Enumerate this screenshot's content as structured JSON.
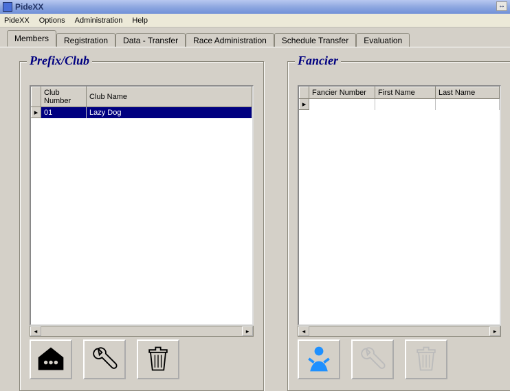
{
  "window": {
    "title": "PideXX"
  },
  "menu": {
    "items": [
      "PideXX",
      "Options",
      "Administration",
      "Help"
    ]
  },
  "tabs": [
    "Members",
    "Registration",
    "Data - Transfer",
    "Race Administration",
    "Schedule Transfer",
    "Evaluation"
  ],
  "active_tab": 0,
  "panel_left": {
    "title": "Prefix/Club",
    "columns": [
      "Club Number",
      "Club Name"
    ],
    "rows": [
      {
        "club_number": "01",
        "club_name": "Lazy Dog",
        "selected": true
      }
    ]
  },
  "panel_right": {
    "title": "Fancier",
    "columns": [
      "Fancier Number",
      "First Name",
      "Last Name"
    ],
    "rows": [
      {
        "fancier_number": "",
        "first_name": "",
        "last_name": "",
        "selected": false
      }
    ]
  }
}
